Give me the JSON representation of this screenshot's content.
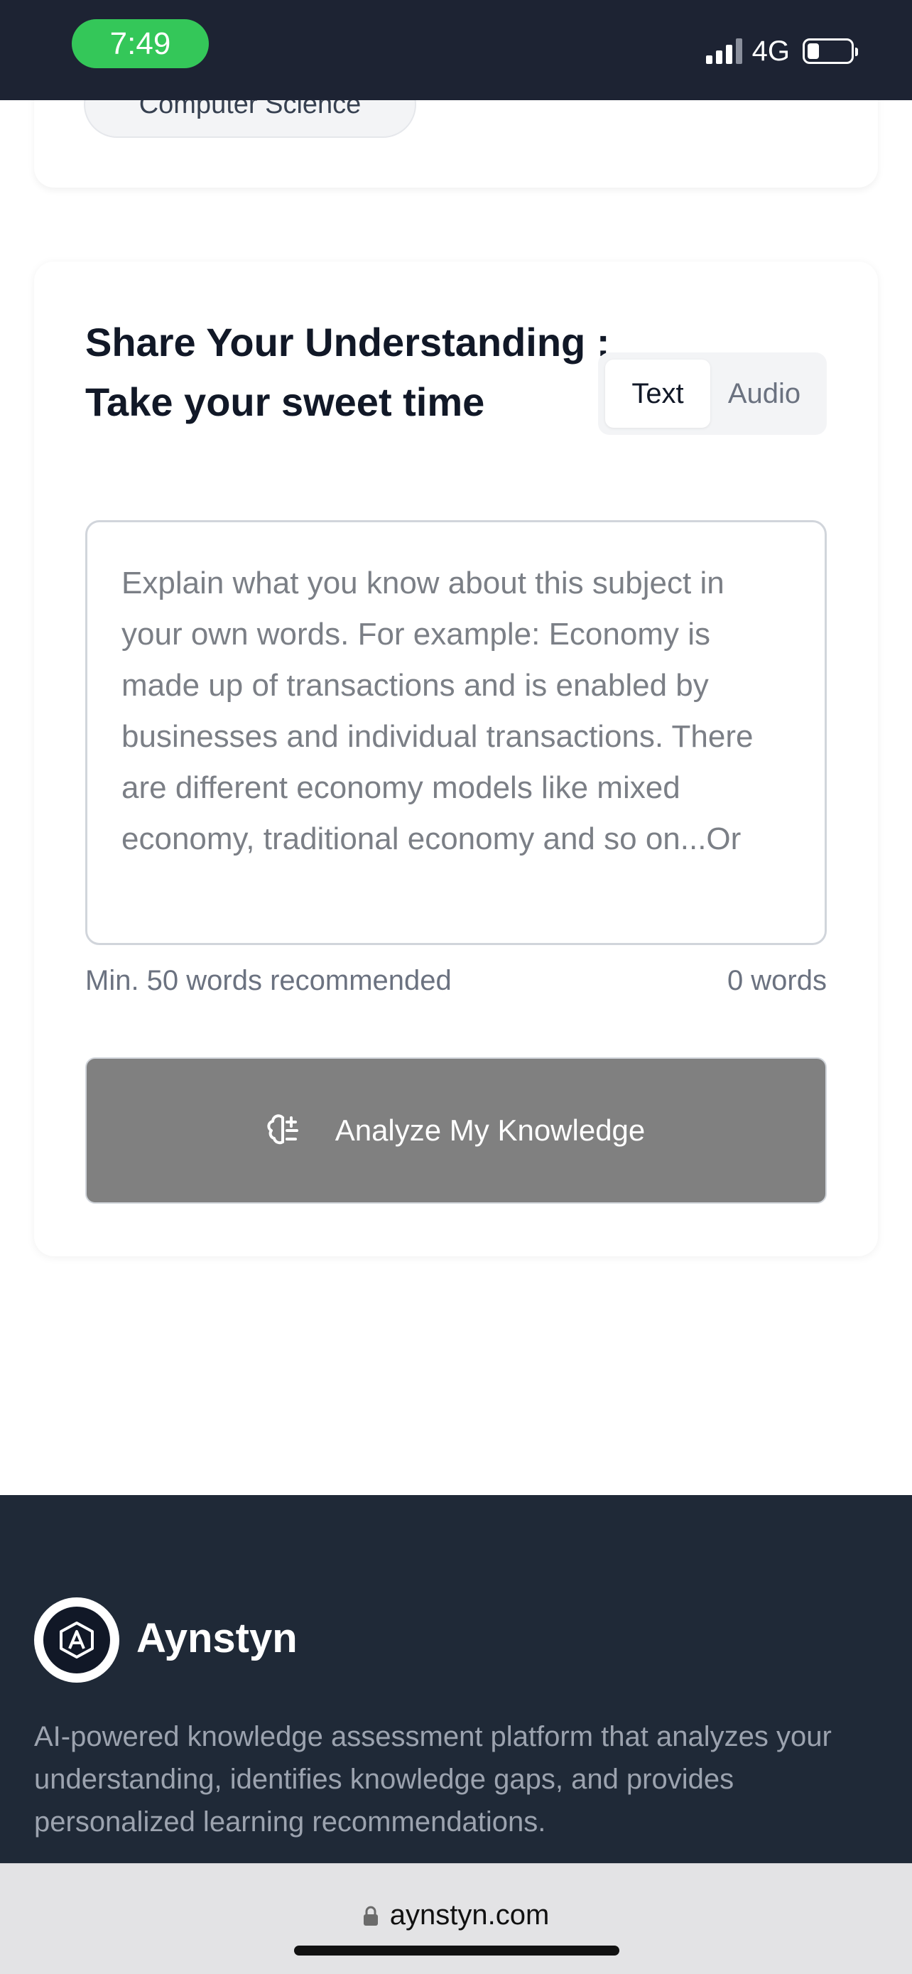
{
  "status_bar": {
    "time": "7:49",
    "network": "4G"
  },
  "top_card": {
    "chip_label": "Computer Science"
  },
  "assessment": {
    "title": "Share Your Understanding : Take your sweet time",
    "mode_options": [
      "Text",
      "Audio"
    ],
    "selected_mode": "Text",
    "input_value": "",
    "input_placeholder": "Explain what you know about this subject in your own words. For example: Economy is made up of transactions and is enabled by businesses and individual transactions. There are different economy models like mixed economy, traditional economy and so on...Or",
    "min_words_hint": "Min. 50 words recommended",
    "word_count": "0 words",
    "analyze_button_label": "Analyze My Knowledge",
    "analyze_button_icon": "brain-icon"
  },
  "footer": {
    "brand_name": "Aynstyn",
    "brand_description": "AI-powered knowledge assessment platform that analyzes your understanding, identifies knowledge gaps, and provides personalized learning recommendations.",
    "logo_icon": "aynstyn-logo-icon"
  },
  "browser": {
    "url": "aynstyn.com"
  },
  "colors": {
    "status_bar_bg": "#1d2333",
    "time_pill": "#34c759",
    "button_disabled": "#808080",
    "footer_bg": "#1f2937"
  }
}
